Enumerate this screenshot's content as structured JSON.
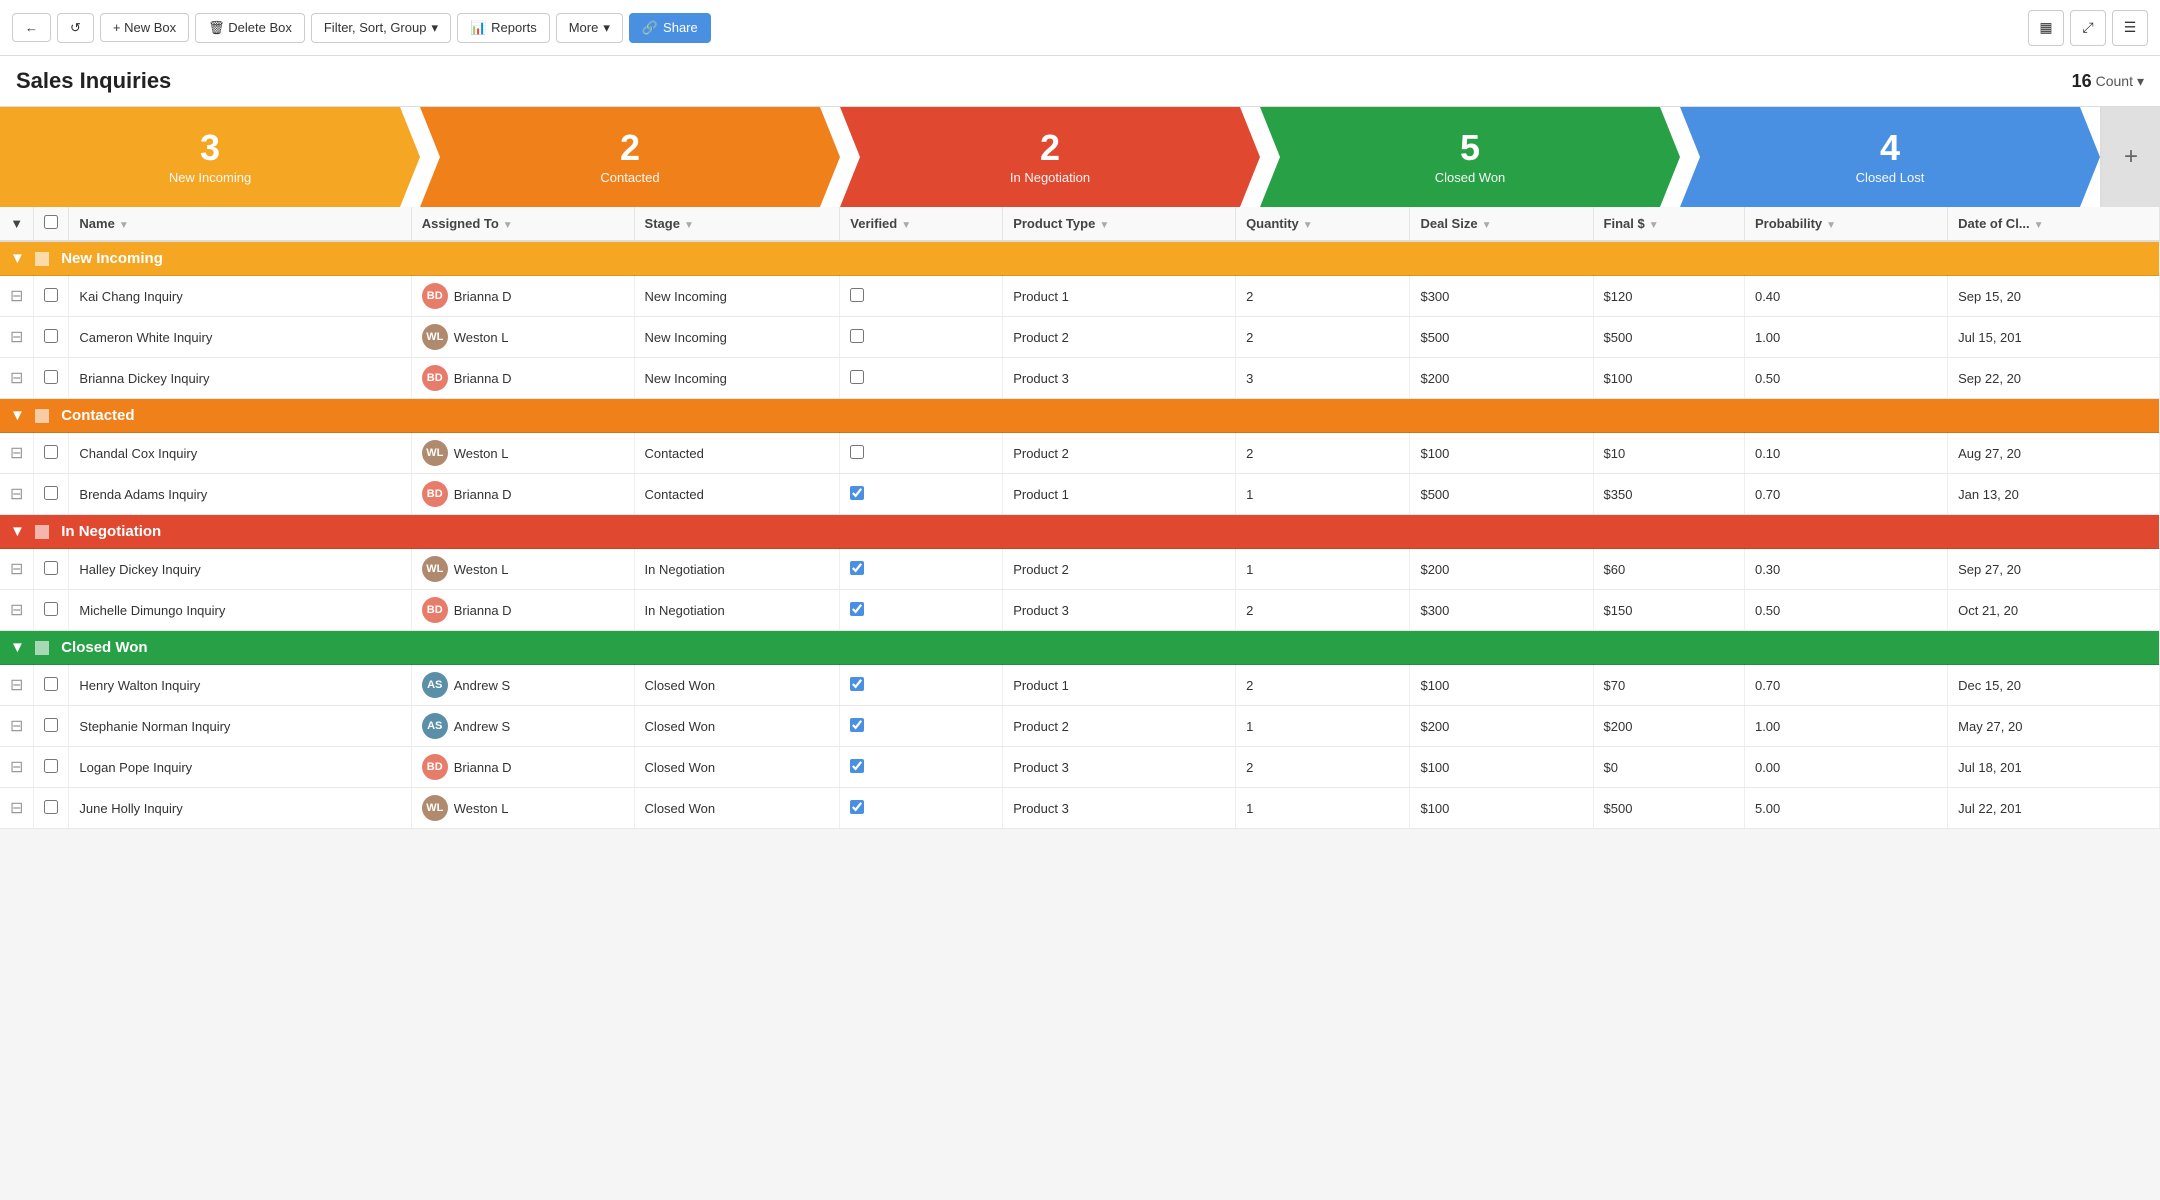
{
  "toolbar": {
    "back_label": "←",
    "refresh_label": "↺",
    "new_box_label": "+ New Box",
    "delete_box_label": "🗑 Delete Box",
    "filter_label": "Filter, Sort, Group",
    "filter_icon": "▾",
    "reports_label": "Reports",
    "more_label": "More",
    "more_icon": "▾",
    "share_label": "Share"
  },
  "title": "Sales Inquiries",
  "count": "16",
  "count_label": "Count",
  "stages": [
    {
      "id": "new-incoming",
      "num": "3",
      "label": "New Incoming",
      "color": "#f5a623"
    },
    {
      "id": "contacted",
      "num": "2",
      "label": "Contacted",
      "color": "#f0811a"
    },
    {
      "id": "in-negotiation",
      "num": "2",
      "label": "In Negotiation",
      "color": "#e04830"
    },
    {
      "id": "closed-won",
      "num": "5",
      "label": "Closed Won",
      "color": "#27a046"
    },
    {
      "id": "closed-lost",
      "num": "4",
      "label": "Closed Lost",
      "color": "#4a90e2"
    }
  ],
  "columns": [
    "Name",
    "Assigned To",
    "Stage",
    "Verified",
    "Product Type",
    "Quantity",
    "Deal Size",
    "Final $",
    "Probability",
    "Date of Cl..."
  ],
  "groups": [
    {
      "id": "new-incoming",
      "label": "New Incoming",
      "class": "new-incoming",
      "rows": [
        {
          "name": "Kai Chang Inquiry",
          "assigned": "Brianna D",
          "assigned_color": "#e87c6a",
          "stage": "New Incoming",
          "verified": false,
          "product": "Product 1",
          "quantity": "2",
          "deal_size": "$300",
          "final": "$120",
          "probability": "0.40",
          "date": "Sep 15, 20"
        },
        {
          "name": "Cameron White Inquiry",
          "assigned": "Weston L",
          "assigned_color": "#b08a6e",
          "stage": "New Incoming",
          "verified": false,
          "product": "Product 2",
          "quantity": "2",
          "deal_size": "$500",
          "final": "$500",
          "probability": "1.00",
          "date": "Jul 15, 201"
        },
        {
          "name": "Brianna Dickey Inquiry",
          "assigned": "Brianna D",
          "assigned_color": "#e87c6a",
          "stage": "New Incoming",
          "verified": false,
          "product": "Product 3",
          "quantity": "3",
          "deal_size": "$200",
          "final": "$100",
          "probability": "0.50",
          "date": "Sep 22, 20"
        }
      ]
    },
    {
      "id": "contacted",
      "label": "Contacted",
      "class": "contacted",
      "rows": [
        {
          "name": "Chandal Cox Inquiry",
          "assigned": "Weston L",
          "assigned_color": "#b08a6e",
          "stage": "Contacted",
          "verified": false,
          "product": "Product 2",
          "quantity": "2",
          "deal_size": "$100",
          "final": "$10",
          "probability": "0.10",
          "date": "Aug 27, 20"
        },
        {
          "name": "Brenda Adams Inquiry",
          "assigned": "Brianna D",
          "assigned_color": "#e87c6a",
          "stage": "Contacted",
          "verified": true,
          "product": "Product 1",
          "quantity": "1",
          "deal_size": "$500",
          "final": "$350",
          "probability": "0.70",
          "date": "Jan 13, 20"
        }
      ]
    },
    {
      "id": "in-negotiation",
      "label": "In Negotiation",
      "class": "in-negotiation",
      "rows": [
        {
          "name": "Halley Dickey Inquiry",
          "assigned": "Weston L",
          "assigned_color": "#b08a6e",
          "stage": "In Negotiation",
          "verified": true,
          "product": "Product 2",
          "quantity": "1",
          "deal_size": "$200",
          "final": "$60",
          "probability": "0.30",
          "date": "Sep 27, 20"
        },
        {
          "name": "Michelle Dimungo Inquiry",
          "assigned": "Brianna D",
          "assigned_color": "#e87c6a",
          "stage": "In Negotiation",
          "verified": true,
          "product": "Product 3",
          "quantity": "2",
          "deal_size": "$300",
          "final": "$150",
          "probability": "0.50",
          "date": "Oct 21, 20"
        }
      ]
    },
    {
      "id": "closed-won",
      "label": "Closed Won",
      "class": "closed-won",
      "rows": [
        {
          "name": "Henry Walton Inquiry",
          "assigned": "Andrew S",
          "assigned_color": "#5b8fa8",
          "stage": "Closed Won",
          "verified": true,
          "product": "Product 1",
          "quantity": "2",
          "deal_size": "$100",
          "final": "$70",
          "probability": "0.70",
          "date": "Dec 15, 20"
        },
        {
          "name": "Stephanie Norman Inquiry",
          "assigned": "Andrew S",
          "assigned_color": "#5b8fa8",
          "stage": "Closed Won",
          "verified": true,
          "product": "Product 2",
          "quantity": "1",
          "deal_size": "$200",
          "final": "$200",
          "probability": "1.00",
          "date": "May 27, 20"
        },
        {
          "name": "Logan Pope Inquiry",
          "assigned": "Brianna D",
          "assigned_color": "#e87c6a",
          "stage": "Closed Won",
          "verified": true,
          "product": "Product 3",
          "quantity": "2",
          "deal_size": "$100",
          "final": "$0",
          "probability": "0.00",
          "date": "Jul 18, 201"
        },
        {
          "name": "June Holly Inquiry",
          "assigned": "Weston L",
          "assigned_color": "#b08a6e",
          "stage": "Closed Won",
          "verified": true,
          "product": "Product 3",
          "quantity": "1",
          "deal_size": "$100",
          "final": "$500",
          "probability": "5.00",
          "date": "Jul 22, 201"
        }
      ]
    }
  ]
}
